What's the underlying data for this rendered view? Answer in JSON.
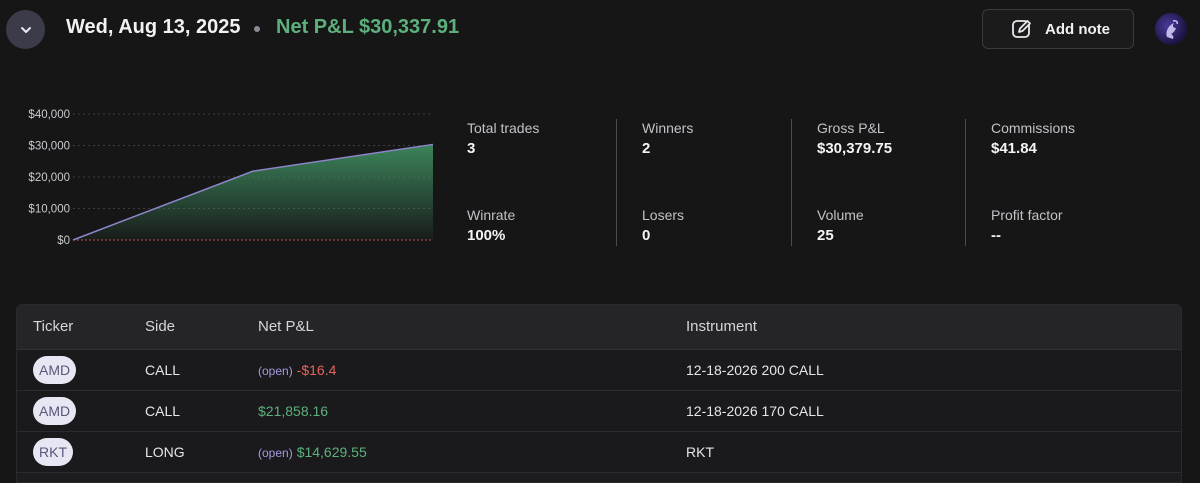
{
  "header": {
    "date": "Wed, Aug 13, 2025",
    "net_pl": "Net P&L $30,337.91",
    "add_note_label": "Add note"
  },
  "stats": {
    "total_trades": {
      "label": "Total trades",
      "value": "3"
    },
    "winners": {
      "label": "Winners",
      "value": "2"
    },
    "gross_pl": {
      "label": "Gross P&L",
      "value": "$30,379.75"
    },
    "commissions": {
      "label": "Commissions",
      "value": "$41.84"
    },
    "winrate": {
      "label": "Winrate",
      "value": "100%"
    },
    "losers": {
      "label": "Losers",
      "value": "0"
    },
    "volume": {
      "label": "Volume",
      "value": "25"
    },
    "profit_factor": {
      "label": "Profit factor",
      "value": "--"
    }
  },
  "chart_data": {
    "type": "area",
    "y_ticks": [
      "$40,000",
      "$30,000",
      "$20,000",
      "$10,000",
      "$0"
    ],
    "ylim": [
      0,
      40000
    ],
    "values": [
      0,
      21858.16,
      30337.91
    ],
    "colors": {
      "line": "#8b85c9",
      "fill_top": "#3e8a5e",
      "zero_line": "#c0504d",
      "grid": "#3d3d42"
    }
  },
  "table": {
    "headers": [
      "Ticker",
      "Side",
      "Net P&L",
      "Instrument"
    ],
    "rows": [
      {
        "ticker": "AMD",
        "side": "CALL",
        "open": "(open)",
        "pl": "-$16.4",
        "instrument": "12-18-2026 200 CALL"
      },
      {
        "ticker": "AMD",
        "side": "CALL",
        "open": "",
        "pl": "$21,858.16",
        "instrument": "12-18-2026 170 CALL"
      },
      {
        "ticker": "RKT",
        "side": "LONG",
        "open": "(open)",
        "pl": "$14,629.55",
        "instrument": "RKT"
      }
    ]
  },
  "icons": {
    "collapse": "chevron-down-icon",
    "add_note": "edit-note-icon",
    "avatar": "user-avatar"
  }
}
